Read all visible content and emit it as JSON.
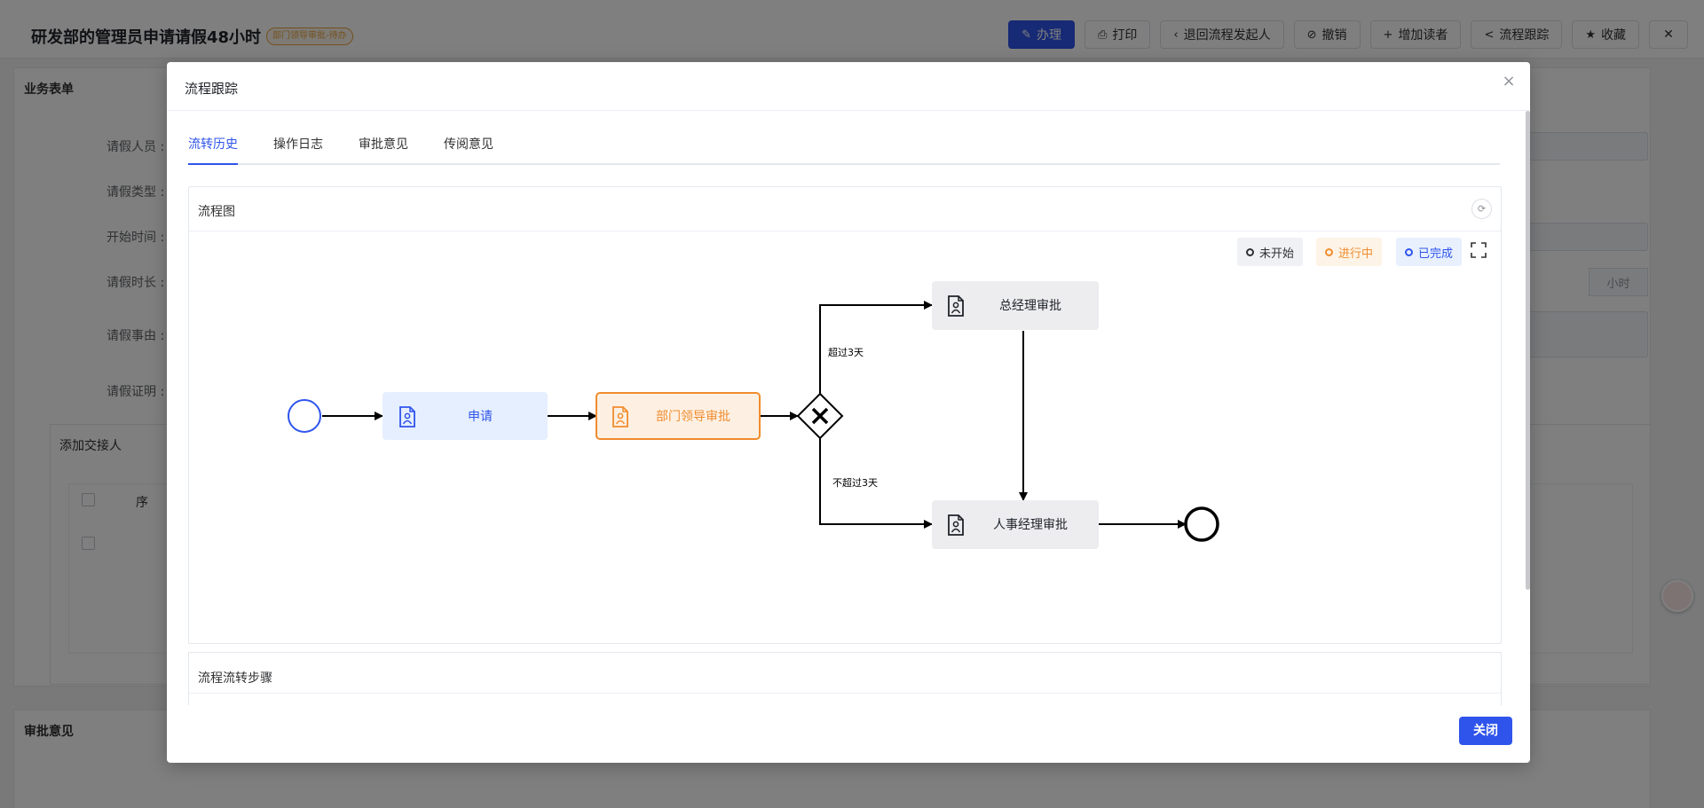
{
  "page": {
    "title": "研发部的管理员申请请假48小时",
    "status": "部门领导审批-待办",
    "actions": [
      "办理",
      "打印",
      "退回流程发起人",
      "撤销",
      "增加读者",
      "流程跟踪",
      "收藏"
    ],
    "form_card_title": "业务表单",
    "fields": [
      "请假人员 :",
      "请假类型 :",
      "开始时间 :",
      "请假时长 :",
      "请假事由 :",
      "请假证明 :"
    ],
    "duration_unit": "小时",
    "handover_title": "添加交接人",
    "handover_col": "序",
    "opinion_title": "审批意见"
  },
  "dialog": {
    "title": "流程跟踪",
    "tabs": [
      "流转历史",
      "操作日志",
      "审批意见",
      "传阅意见"
    ],
    "active_tab": 0,
    "flow_card_title": "流程图",
    "legend": {
      "not_started": "未开始",
      "in_progress": "进行中",
      "completed": "已完成"
    },
    "nodes": {
      "apply": "申请",
      "dept_leader": "部门领导审批",
      "gm": "总经理审批",
      "hr": "人事经理审批"
    },
    "edge_labels": {
      "over": "超过3天",
      "not_over": "不超过3天"
    },
    "steps_title": "流程流转步骤",
    "close_button": "关闭"
  },
  "colors": {
    "primary": "#2f54eb",
    "in_progress": "#f08c2e",
    "completed_fill": "#e6efff",
    "in_progress_fill": "#fdf0e3",
    "pending_fill": "#ededf0"
  }
}
